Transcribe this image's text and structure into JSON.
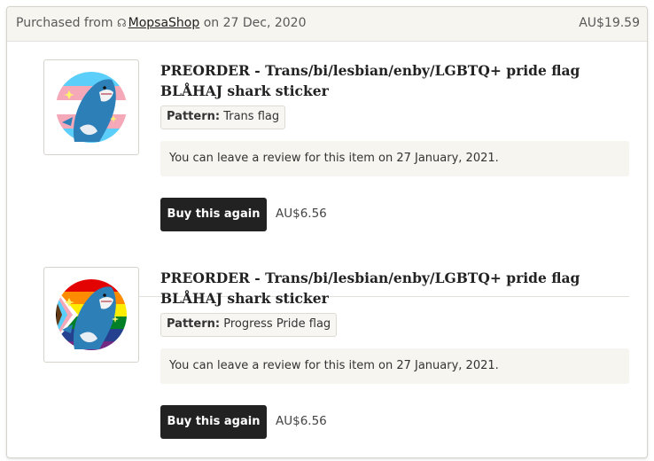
{
  "header": {
    "purchased_from": "Purchased from",
    "shop_icon": "storefront-icon",
    "shop_name": "MopsaShop",
    "date_text": "on 27 Dec, 2020",
    "total": "AU$19.59"
  },
  "items": [
    {
      "title": "PREORDER - Trans/bi/lesbian/enby/LGBTQ+ pride flag BLÅHAJ shark sticker",
      "pattern_label": "Pattern:",
      "pattern_value": "Trans flag",
      "review_note": "You can leave a review for this item on 27 January, 2021.",
      "buy_label": "Buy this again",
      "price": "AU$6.56",
      "image": "trans-flag-shark-sticker"
    },
    {
      "title": "PREORDER - Trans/bi/lesbian/enby/LGBTQ+ pride flag BLÅHAJ shark sticker",
      "pattern_label": "Pattern:",
      "pattern_value": "Progress Pride flag",
      "review_note": "You can leave a review for this item on 27 January, 2021.",
      "buy_label": "Buy this again",
      "price": "AU$6.56",
      "image": "progress-pride-flag-shark-sticker"
    }
  ],
  "colors": {
    "button_bg": "#222222",
    "header_bg": "#f6f5f0",
    "note_bg": "#f7f5ef",
    "trans_blue": "#5bcefa",
    "trans_pink": "#f5a9b8",
    "shark_blue": "#2d7fb8"
  }
}
